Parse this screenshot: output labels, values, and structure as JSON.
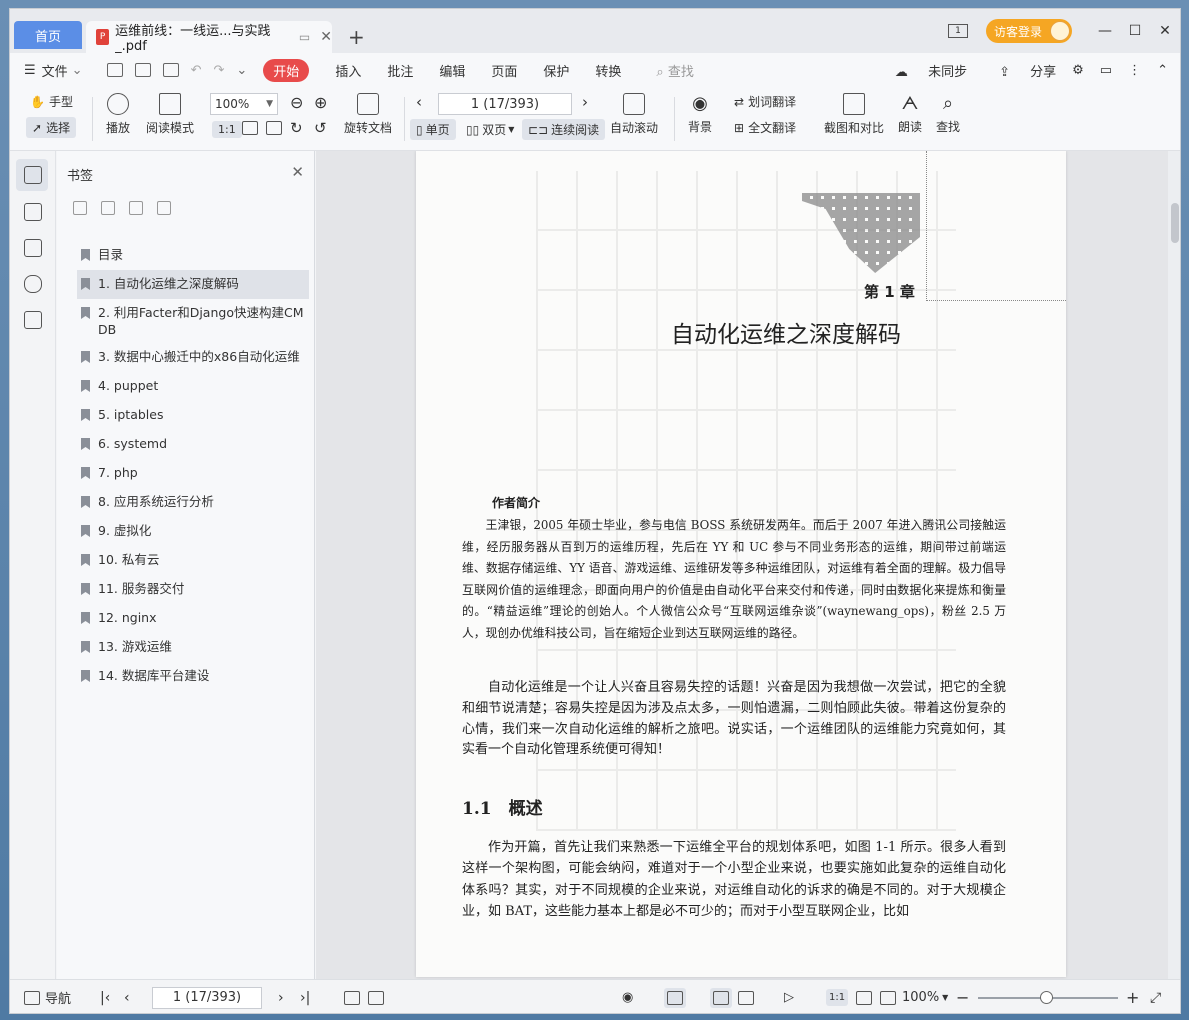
{
  "tabs": {
    "home": "首页",
    "document": "运维前线：一线运...与实践_.pdf",
    "new_tab": "+"
  },
  "titlebar": {
    "window_count": "1",
    "guest_login": "访客登录",
    "minimize": "—",
    "maximize": "☐",
    "close": "✕"
  },
  "menu": {
    "file": "文件",
    "start": "开始",
    "items": [
      "插入",
      "批注",
      "编辑",
      "页面",
      "保护",
      "转换"
    ],
    "search": "查找",
    "sync": "未同步",
    "share": "分享"
  },
  "ribbon": {
    "hand": "手型",
    "select": "选择",
    "play": "播放",
    "read_mode": "阅读模式",
    "zoom": "100%",
    "rotate_doc": "旋转文档",
    "page_indicator": "1 (17/393)",
    "auto_scroll": "自动滚动",
    "single_page": "单页",
    "double_page": "双页",
    "continuous": "连续阅读",
    "background": "背景",
    "word_translate": "划词翻译",
    "full_translate": "全文翻译",
    "screenshot_compare": "截图和对比",
    "read_aloud": "朗读",
    "find": "查找"
  },
  "bookmarks": {
    "title": "书签",
    "items": [
      "目录",
      "1. 自动化运维之深度解码",
      "2. 利用Facter和Django快速构建CMDB",
      "3. 数据中心搬迁中的x86自动化运维",
      "4. puppet",
      "5. iptables",
      "6. systemd",
      "7. php",
      "8. 应用系统运行分析",
      "9. 虚拟化",
      "10. 私有云",
      "11. 服务器交付",
      "12. nginx",
      "13. 游戏运维",
      "14. 数据库平台建设"
    ]
  },
  "page": {
    "chapter": "第 1 章",
    "chapter_title": "自动化运维之深度解码",
    "author_heading": "作者简介",
    "author_bio": "王津银，2005 年硕士毕业，参与电信 BOSS 系统研发两年。而后于 2007 年进入腾讯公司接触运维，经历服务器从百到万的运维历程，先后在 YY 和 UC 参与不同业务形态的运维，期间带过前端运维、数据存储运维、YY 语音、游戏运维、运维研发等多种运维团队，对运维有着全面的理解。极力倡导互联网价值的运维理念，即面向用户的价值是由自动化平台来交付和传递，同时由数据化来提炼和衡量的。“精益运维”理论的创始人。个人微信公众号“互联网运维杂谈”(waynewang_ops)，粉丝 2.5 万人，现创办优维科技公司，旨在缩短企业到达互联网运维的路径。",
    "intro": "自动化运维是一个让人兴奋且容易失控的话题！兴奋是因为我想做一次尝试，把它的全貌和细节说清楚；容易失控是因为涉及点太多，一则怕遗漏，二则怕顾此失彼。带着这份复杂的心情，我们来一次自动化运维的解析之旅吧。说实话，一个运维团队的运维能力究竟如何，其实看一个自动化管理系统便可得知！",
    "section": "1.1　概述",
    "section_text": "作为开篇，首先让我们来熟悉一下运维全平台的规划体系吧，如图 1-1 所示。很多人看到这样一个架构图，可能会纳闷，难道对于一个小型企业来说，也要实施如此复杂的运维自动化体系吗？其实，对于不同规模的企业来说，对运维自动化的诉求的确是不同的。对于大规模企业，如 BAT，这些能力基本上都是必不可少的；而对于小型互联网企业，比如"
  },
  "status": {
    "nav": "导航",
    "page_indicator": "1 (17/393)",
    "zoom": "100%"
  }
}
